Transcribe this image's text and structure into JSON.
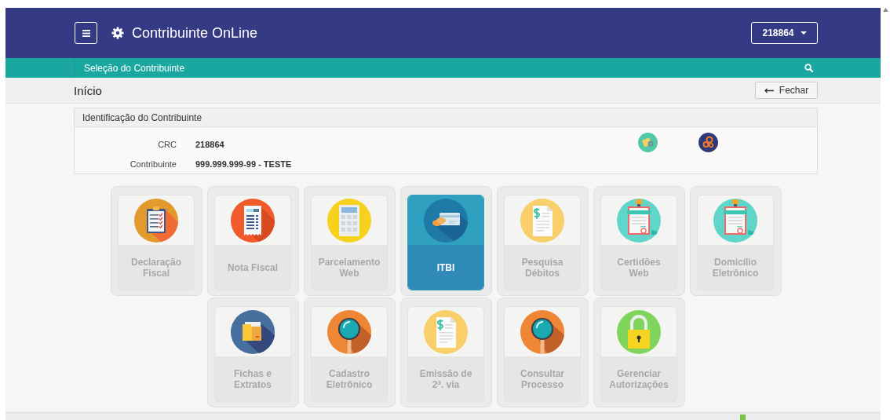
{
  "header": {
    "title": "Contribuinte OnLine",
    "account": "218864"
  },
  "search_bar": {
    "label": "Seleção do Contribuinte"
  },
  "breadcrumb": {
    "title": "Início",
    "close_button": "Fechar"
  },
  "identification": {
    "title": "Identificação do Contribuinte",
    "fields": [
      {
        "label": "CRC",
        "value": "218864"
      },
      {
        "label": "Contribuinte",
        "value": "999.999.999-99 - TESTE"
      }
    ]
  },
  "tiles": [
    {
      "label": "Declaração Fiscal",
      "kind": "clipboard",
      "selected": false
    },
    {
      "label": "Nota Fiscal",
      "kind": "receipt",
      "selected": false
    },
    {
      "label": "Parcelamento Web",
      "kind": "calculator",
      "selected": false
    },
    {
      "label": "ITBI",
      "kind": "payment",
      "selected": true
    },
    {
      "label": "Pesquisa Débitos",
      "kind": "document",
      "selected": false
    },
    {
      "label": "Certidões Web",
      "kind": "certificate",
      "selected": false
    },
    {
      "label": "Domicílio Eletrônico",
      "kind": "certificate",
      "selected": false
    },
    {
      "label": "Fichas e Extratos",
      "kind": "folder",
      "selected": false
    },
    {
      "label": "Cadastro Eletrônico",
      "kind": "magnifier",
      "selected": false
    },
    {
      "label": "Emissão de 2ª. via",
      "kind": "document",
      "selected": false
    },
    {
      "label": "Consultar Processo",
      "kind": "magnifier",
      "selected": false
    },
    {
      "label": "Gerenciar Autorizações",
      "kind": "padlock",
      "selected": false
    }
  ]
}
